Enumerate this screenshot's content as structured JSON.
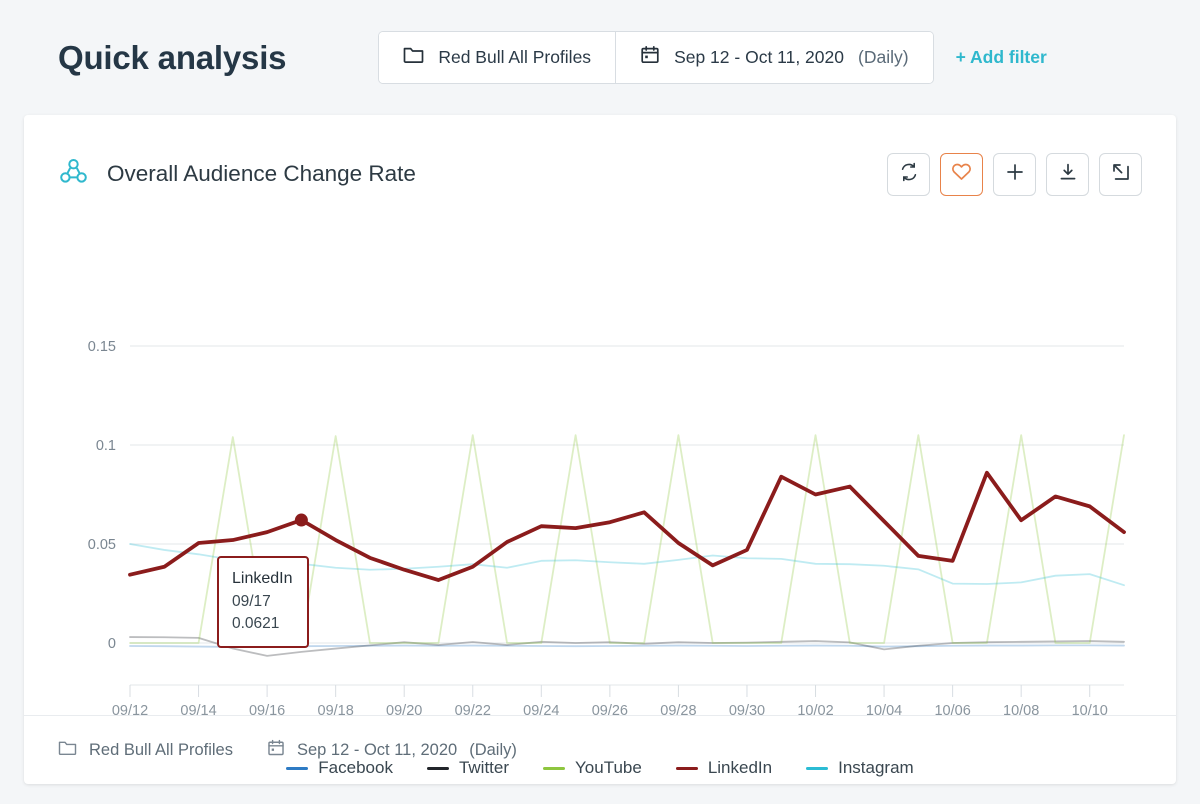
{
  "header": {
    "title": "Quick analysis",
    "profile_filter": {
      "icon": "folder-icon",
      "label": "Red Bull All Profiles"
    },
    "date_filter": {
      "icon": "calendar-icon",
      "label": "Sep 12 - Oct 11, 2020",
      "granularity": "(Daily)"
    },
    "add_filter_label": "+ Add filter"
  },
  "card": {
    "icon": "audience-network-icon",
    "title": "Overall Audience Change Rate",
    "actions": [
      {
        "name": "refresh-button",
        "icon": "refresh-icon",
        "active": false
      },
      {
        "name": "favorite-button",
        "icon": "heart-icon",
        "active": true
      },
      {
        "name": "add-button",
        "icon": "plus-icon",
        "active": false
      },
      {
        "name": "download-button",
        "icon": "download-icon",
        "active": false
      },
      {
        "name": "open-external-button",
        "icon": "external-link-icon",
        "active": false
      }
    ]
  },
  "tooltip": {
    "series": "LinkedIn",
    "date": "09/17",
    "value": "0.0621"
  },
  "footer": {
    "profile": {
      "icon": "folder-icon",
      "label": "Red Bull All Profiles"
    },
    "date": {
      "icon": "calendar-icon",
      "label": "Sep 12 - Oct 11, 2020",
      "granularity": "(Daily)"
    }
  },
  "colors": {
    "accent_teal": "#2fb8cd",
    "favorite_orange": "#e8834a",
    "facebook": "#2e7bc4",
    "twitter": "#22252a",
    "youtube": "#8ec63f",
    "linkedin": "#8b1c1c",
    "instagram": "#2bbcd4",
    "title_navy": "#253746",
    "grid": "#e3e7ea"
  },
  "chart_data": {
    "type": "line",
    "title": "Overall Audience Change Rate",
    "xlabel": "",
    "ylabel": "",
    "ylim": [
      -0.02,
      0.16
    ],
    "yticks": [
      0,
      0.05,
      0.1,
      0.15
    ],
    "ytick_labels": [
      "0",
      "0.05",
      "0.1",
      "0.15"
    ],
    "grid": true,
    "legend_position": "bottom",
    "x": [
      "09/12",
      "09/13",
      "09/14",
      "09/15",
      "09/16",
      "09/17",
      "09/18",
      "09/19",
      "09/20",
      "09/21",
      "09/22",
      "09/23",
      "09/24",
      "09/25",
      "09/26",
      "09/27",
      "09/28",
      "09/29",
      "09/30",
      "10/01",
      "10/02",
      "10/03",
      "10/04",
      "10/05",
      "10/06",
      "10/07",
      "10/08",
      "10/09",
      "10/10",
      "10/11"
    ],
    "xtick_labels": [
      "09/12",
      "09/14",
      "09/16",
      "09/18",
      "09/20",
      "09/22",
      "09/24",
      "09/26",
      "09/28",
      "09/30",
      "10/02",
      "10/04",
      "10/06",
      "10/08",
      "10/10"
    ],
    "series": [
      {
        "name": "Facebook",
        "color": "#2e7bc4",
        "emphasis": "muted",
        "values": [
          -0.0015,
          -0.0016,
          -0.0018,
          -0.002,
          -0.0018,
          -0.0016,
          -0.0015,
          -0.0014,
          -0.0013,
          -0.0014,
          -0.0013,
          -0.0014,
          -0.0015,
          -0.0016,
          -0.0015,
          -0.0014,
          -0.0013,
          -0.0014,
          -0.0015,
          -0.0014,
          -0.0013,
          -0.0014,
          -0.0018,
          -0.0016,
          -0.0014,
          -0.0013,
          -0.0013,
          -0.0012,
          -0.0012,
          -0.0013
        ]
      },
      {
        "name": "Twitter",
        "color": "#22252a",
        "emphasis": "muted",
        "values": [
          0.003,
          0.0029,
          0.0026,
          -0.0028,
          -0.0065,
          -0.0045,
          -0.0028,
          -0.0012,
          0.0004,
          -0.001,
          0.0005,
          -0.001,
          0.0006,
          0.0,
          0.0004,
          -0.0004,
          0.0004,
          0.0,
          0.0002,
          0.0006,
          0.001,
          0.0003,
          -0.0032,
          -0.0014,
          0.0,
          0.0004,
          0.0006,
          0.0008,
          0.001,
          0.0006
        ]
      },
      {
        "name": "YouTube",
        "color": "#8ec63f",
        "emphasis": "muted",
        "values": [
          0.0,
          0.0,
          0.0,
          0.104,
          0.0,
          0.0,
          0.1045,
          0.0,
          0.0,
          0.0,
          0.105,
          0.0,
          0.0,
          0.105,
          0.0,
          0.0,
          0.105,
          0.0,
          0.0,
          0.0,
          0.105,
          0.0,
          0.0,
          0.105,
          0.0,
          0.0,
          0.105,
          0.0,
          0.0,
          0.105
        ]
      },
      {
        "name": "LinkedIn",
        "color": "#8b1c1c",
        "emphasis": "highlight",
        "values": [
          0.0345,
          0.0385,
          0.0505,
          0.052,
          0.056,
          0.0621,
          0.052,
          0.043,
          0.037,
          0.0318,
          0.0385,
          0.051,
          0.059,
          0.058,
          0.061,
          0.066,
          0.0505,
          0.0392,
          0.047,
          0.084,
          0.075,
          0.079,
          0.0615,
          0.044,
          0.0415,
          0.086,
          0.062,
          0.074,
          0.069,
          0.056
        ]
      },
      {
        "name": "Instagram",
        "color": "#2bbcd4",
        "emphasis": "muted",
        "values": [
          0.05,
          0.047,
          0.0448,
          0.042,
          0.0405,
          0.04,
          0.038,
          0.037,
          0.0375,
          0.0385,
          0.0398,
          0.038,
          0.0415,
          0.0418,
          0.0408,
          0.04,
          0.042,
          0.0442,
          0.0428,
          0.0425,
          0.04,
          0.0398,
          0.039,
          0.0372,
          0.03,
          0.0298,
          0.0306,
          0.034,
          0.0348,
          0.0292
        ]
      }
    ],
    "annotation": {
      "series": "LinkedIn",
      "date": "09/17",
      "value": 0.0621
    }
  }
}
